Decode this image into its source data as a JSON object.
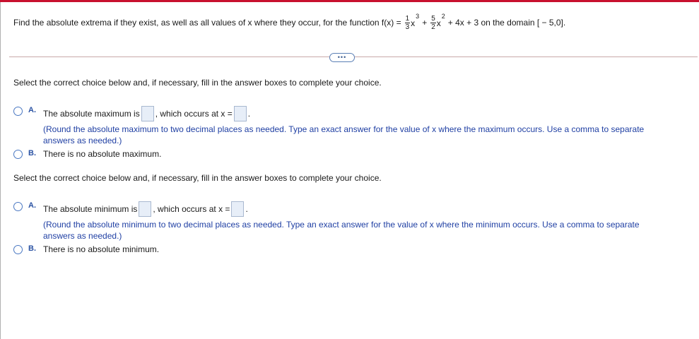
{
  "question": {
    "prefix": "Find the absolute extrema if they exist, as well as all values of x where they occur, for the function f(x) =",
    "term1_num": "1",
    "term1_den": "3",
    "term1_var": "x",
    "term1_exp": "3",
    "plus": "+",
    "term2_num": "5",
    "term2_den": "2",
    "term2_var": "x",
    "term2_exp": "2",
    "rest": "+ 4x + 3 on the domain [ − 5,0]."
  },
  "more_button": {
    "label": "•••"
  },
  "part1": {
    "instruction": "Select the correct choice below and, if necessary, fill in the answer boxes to complete your choice.",
    "option_a": {
      "letter": "A.",
      "text_before": "The absolute maximum is",
      "text_middle": ", which occurs at x =",
      "text_after": ".",
      "hint": "(Round the absolute maximum to two decimal places as needed. Type an exact answer for the value of x where the maximum occurs. Use a comma to separate answers as needed.)"
    },
    "option_b": {
      "letter": "B.",
      "text": "There is no absolute maximum."
    }
  },
  "part2": {
    "instruction": "Select the correct choice below and, if necessary, fill in the answer boxes to complete your choice.",
    "option_a": {
      "letter": "A.",
      "text_before": "The absolute minimum is",
      "text_middle": ", which occurs at x =",
      "text_after": ".",
      "hint": "(Round the absolute minimum to two decimal places as needed. Type an exact answer for the value of x where the minimum occurs. Use a comma to separate answers as needed.)"
    },
    "option_b": {
      "letter": "B.",
      "text": "There is no absolute minimum."
    }
  },
  "colors": {
    "accent_bar": "#c8102e",
    "radio": "#4a78c2",
    "hint_text": "#1f3fa3",
    "answer_box": "#e7eef8"
  }
}
